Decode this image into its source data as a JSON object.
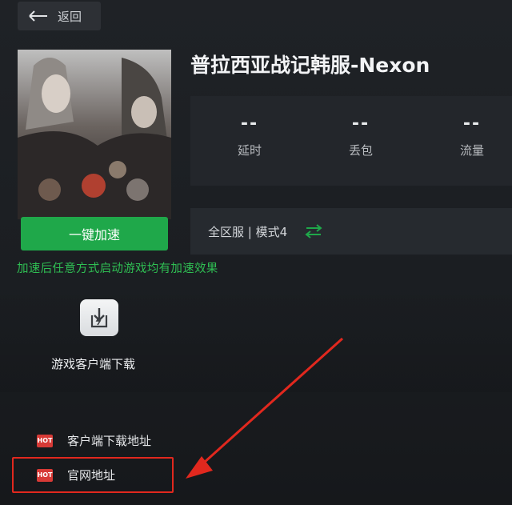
{
  "header": {
    "back_label": "返回"
  },
  "game": {
    "title": "普拉西亚战记韩服-Nexon"
  },
  "stats": [
    {
      "value": "--",
      "label": "延时"
    },
    {
      "value": "--",
      "label": "丢包"
    },
    {
      "value": "--",
      "label": "流量"
    }
  ],
  "server": {
    "label": "全区服 | 模式4",
    "swap_icon": "swap-arrows-icon",
    "swap_color": "#1fa84a"
  },
  "accelerate": {
    "label": "一键加速",
    "hint": "加速后任意方式启动游戏均有加速效果",
    "color": "#1fa84a"
  },
  "download": {
    "icon": "download-box-icon",
    "label": "游戏客户端下载"
  },
  "links": [
    {
      "badge": "HOT",
      "label": "客户端下载地址"
    },
    {
      "badge": "HOT",
      "label": "官网地址"
    }
  ],
  "annotation": {
    "color": "#e1281e"
  }
}
